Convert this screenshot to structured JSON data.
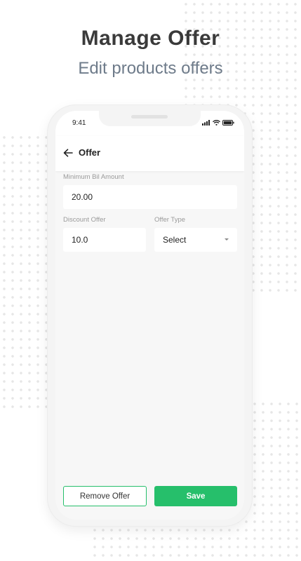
{
  "header": {
    "title": "Manage Offer",
    "subtitle": "Edit products offers"
  },
  "status_bar": {
    "time": "9:41",
    "icons": [
      "signal-icon",
      "wifi-icon",
      "battery-icon"
    ]
  },
  "app_bar": {
    "back_icon": "arrow-left-icon",
    "title": "Offer"
  },
  "form": {
    "min_bill": {
      "label": "Minimum Bil Amount",
      "value": "20.00"
    },
    "discount": {
      "label": "Discount Offer",
      "value": "10.0"
    },
    "offer_type": {
      "label": "Offer Type",
      "selected": "Select"
    }
  },
  "actions": {
    "remove_label": "Remove Offer",
    "save_label": "Save"
  },
  "colors": {
    "accent": "#26bf6b",
    "subtitle": "#6e7b8a",
    "background": "#ffffff"
  }
}
